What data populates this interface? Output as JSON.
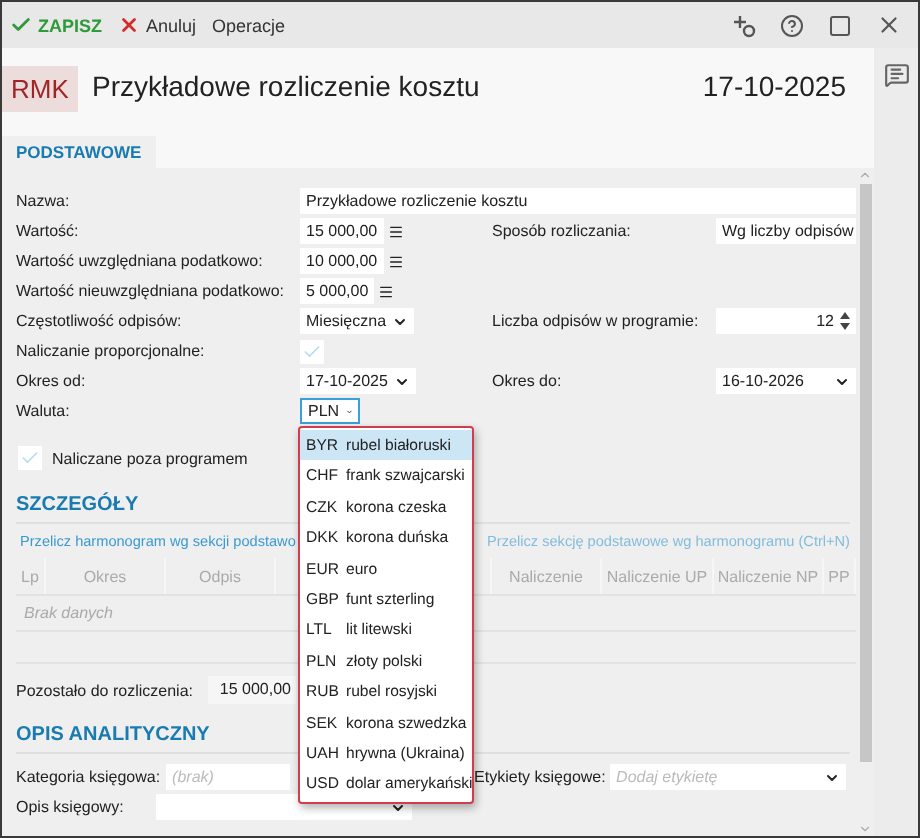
{
  "toolbar": [
    {
      "kind": "save",
      "label": "ZAPISZ"
    },
    {
      "kind": "cancel",
      "label": "Anuluj"
    },
    {
      "kind": "plain",
      "label": "Operacje"
    }
  ],
  "header": {
    "badge": "RMK",
    "title": "Przykładowe rozliczenie kosztu",
    "date": "17-10-2025"
  },
  "tabs": [
    {
      "label": "PODSTAWOWE",
      "selected": true
    }
  ],
  "form": [
    {
      "left": {
        "label": "Nazwa:",
        "kind": "text",
        "value": "Przykładowe rozliczenie kosztu"
      }
    },
    {
      "left": {
        "label": "Wartość:",
        "kind": "amount",
        "value": "15 000,00"
      },
      "right": {
        "label": "Sposób rozliczania:",
        "kind": "select",
        "value": "Wg liczby odpisów"
      }
    },
    {
      "left": {
        "label": "Wartość uwzględniana podatkowo:",
        "kind": "amount",
        "value": "10 000,00"
      }
    },
    {
      "left": {
        "label": "Wartość nieuwzględniana podatkowo:",
        "kind": "amount",
        "value": "5 000,00"
      }
    },
    {
      "left": {
        "label": "Częstotliwość odpisów:",
        "kind": "select",
        "value": "Miesięczna"
      },
      "right": {
        "label": "Liczba odpisów w programie:",
        "kind": "spinner",
        "value": "12"
      }
    },
    {
      "left": {
        "label": "Naliczanie proporcjonalne:",
        "kind": "checkbox",
        "checked": true
      }
    },
    {
      "left": {
        "label": "Okres od:",
        "kind": "select",
        "value": "17-10-2025"
      },
      "right": {
        "label": "Okres do:",
        "kind": "select",
        "value": "16-10-2026"
      }
    },
    {
      "left": {
        "label": "Waluta:",
        "kind": "currency",
        "value": "PLN",
        "expanded": true
      }
    }
  ],
  "outside_program": {
    "label": "Naliczane poza programem",
    "checked": true
  },
  "currency_options": [
    {
      "code": "BYR",
      "name": "rubel białoruski",
      "selected": true
    },
    {
      "code": "CHF",
      "name": "frank szwajcarski",
      "selected": false
    },
    {
      "code": "CZK",
      "name": "korona czeska",
      "selected": false
    },
    {
      "code": "DKK",
      "name": "korona duńska",
      "selected": false
    },
    {
      "code": "EUR",
      "name": "euro",
      "selected": false
    },
    {
      "code": "GBP",
      "name": "funt szterling",
      "selected": false
    },
    {
      "code": "LTL",
      "name": "lit litewski",
      "selected": false
    },
    {
      "code": "PLN",
      "name": "złoty polski",
      "selected": false
    },
    {
      "code": "RUB",
      "name": "rubel rosyjski",
      "selected": false
    },
    {
      "code": "SEK",
      "name": "korona szwedzka",
      "selected": false
    },
    {
      "code": "UAH",
      "name": "hrywna (Ukraina)",
      "selected": false
    },
    {
      "code": "USD",
      "name": "dolar amerykański",
      "selected": false
    }
  ],
  "details": {
    "title": "SZCZEGÓŁY",
    "actions": [
      "Przelicz harmonogram wg sekcji podstawo",
      "Przelicz sekcję podstawowe wg harmonogramu (Ctrl+N)"
    ],
    "columns": [
      "Lp",
      "Okres",
      "Odpis",
      "Naliczenie",
      "Naliczenie UP",
      "Naliczenie NP",
      "PP"
    ],
    "empty": "Brak danych",
    "remaining_label": "Pozostało do rozliczenia:",
    "remaining_value": "15 000,00"
  },
  "analytics": {
    "title": "OPIS ANALITYCZNY",
    "category_label": "Kategoria księgowa:",
    "category_placeholder": "(brak)",
    "labels_label": "Etykiety księgowe:",
    "labels_placeholder": "Dodaj etykietę",
    "description_label": "Opis księgowy:"
  }
}
